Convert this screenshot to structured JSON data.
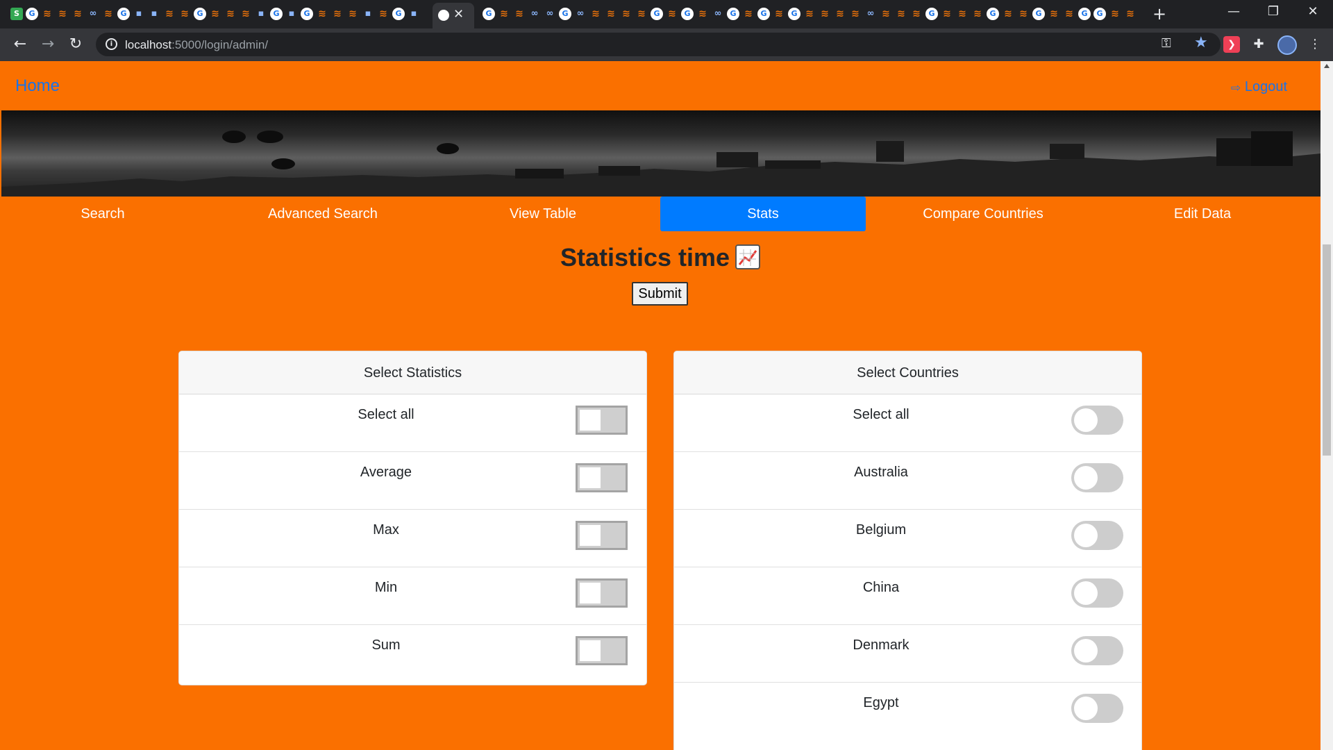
{
  "browser": {
    "url_host": "localhost",
    "url_rest": ":5000/login/admin/",
    "new_tab": "+",
    "close_tab": "✕",
    "minimize": "—",
    "restore": "❐",
    "close_window": "✕"
  },
  "nav": {
    "home": "Home",
    "logout": "Logout"
  },
  "tabs": [
    {
      "label": "Search"
    },
    {
      "label": "Advanced Search"
    },
    {
      "label": "View Table"
    },
    {
      "label": "Stats",
      "active": true
    },
    {
      "label": "Compare Countries"
    },
    {
      "label": "Edit Data"
    }
  ],
  "page": {
    "title": "Statistics time",
    "submit": "Submit"
  },
  "statistics_card": {
    "header": "Select Statistics",
    "items": [
      {
        "label": "Select all",
        "checked": false
      },
      {
        "label": "Average",
        "checked": false
      },
      {
        "label": "Max",
        "checked": false
      },
      {
        "label": "Min",
        "checked": false
      },
      {
        "label": "Sum",
        "checked": false
      }
    ]
  },
  "countries_card": {
    "header": "Select Countries",
    "items": [
      {
        "label": "Select all",
        "checked": false
      },
      {
        "label": "Australia",
        "checked": false
      },
      {
        "label": "Belgium",
        "checked": false
      },
      {
        "label": "China",
        "checked": false
      },
      {
        "label": "Denmark",
        "checked": false
      },
      {
        "label": "Egypt",
        "checked": false
      }
    ]
  },
  "colors": {
    "page_background": "#fa7000",
    "active_tab": "#007bff",
    "link": "#1a73e8"
  }
}
